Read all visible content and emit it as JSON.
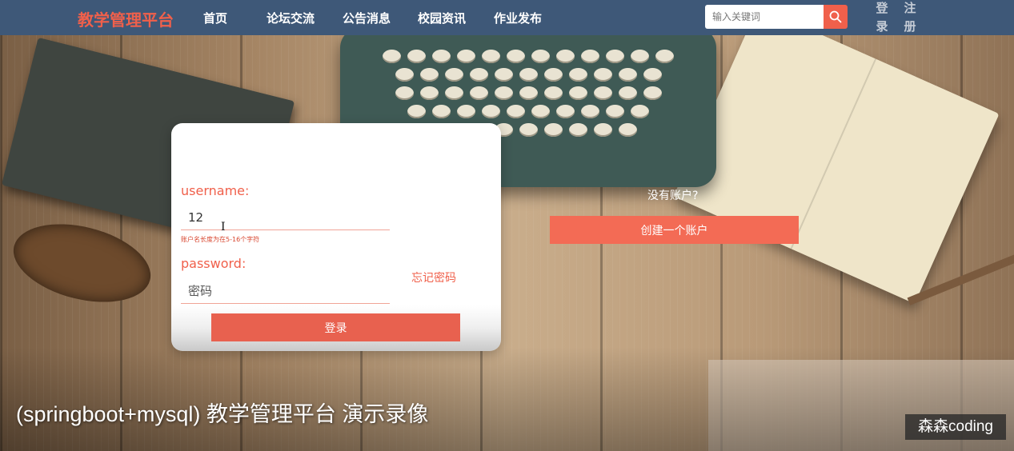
{
  "navbar": {
    "brand": "教学管理平台",
    "items": [
      {
        "label": "首页"
      },
      {
        "label": "论坛交流"
      },
      {
        "label": "公告消息"
      },
      {
        "label": "校园资讯"
      },
      {
        "label": "作业发布"
      }
    ],
    "search": {
      "placeholder": "输入关键词",
      "icon": "search-icon"
    },
    "login_chars": [
      "登",
      "录"
    ],
    "register_chars": [
      "注",
      "册"
    ]
  },
  "login_form": {
    "username_label": "username:",
    "username_value": "12",
    "username_hint": "账户名长度为在5-16个字符",
    "password_label": "password:",
    "password_placeholder": "密码",
    "forgot_label": "忘记密码",
    "submit_label": "登录"
  },
  "register_panel": {
    "prompt": "没有账户?",
    "button_label": "创建一个账户"
  },
  "overlay": {
    "caption": "(springboot+mysql) 教学管理平台 演示录像",
    "watermark": "森森coding"
  },
  "colors": {
    "nav_bg": "#3e5878",
    "accent": "#f0604b",
    "button": "#e8614f"
  }
}
